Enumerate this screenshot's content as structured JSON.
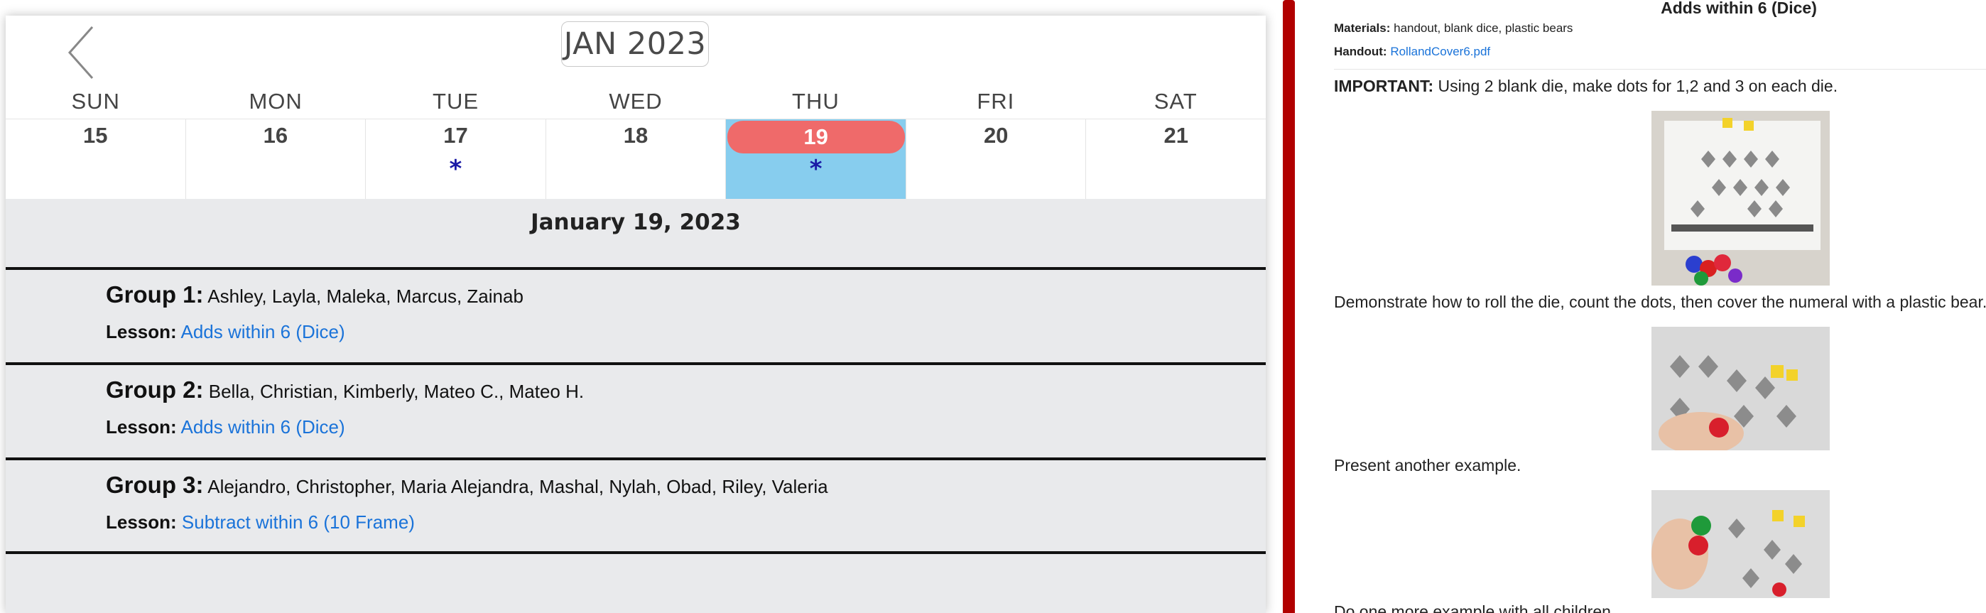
{
  "calendar": {
    "month_title": "JAN 2023",
    "prev_icon": "chevron-left-icon",
    "weekdays": [
      "SUN",
      "MON",
      "TUE",
      "WED",
      "THU",
      "FRI",
      "SAT"
    ],
    "days": [
      {
        "number": "15",
        "marker": ""
      },
      {
        "number": "16",
        "marker": ""
      },
      {
        "number": "17",
        "marker": "*"
      },
      {
        "number": "18",
        "marker": ""
      },
      {
        "number": "19",
        "marker": "*"
      },
      {
        "number": "20",
        "marker": ""
      },
      {
        "number": "21",
        "marker": ""
      }
    ],
    "selected_color": "#87cdee",
    "today_pill_color": "#ef6a6a"
  },
  "day_view": {
    "date_heading": "January 19, 2023",
    "lesson_label": "Lesson:",
    "groups": [
      {
        "name": "Group 1:",
        "students": "Ashley, Layla, Maleka, Marcus, Zainab",
        "lesson": "Adds within 6 (Dice)"
      },
      {
        "name": "Group 2:",
        "students": "Bella, Christian, Kimberly, Mateo C., Mateo H.",
        "lesson": "Adds within 6 (Dice)"
      },
      {
        "name": "Group 3:",
        "students": "Alejandro, Christopher, Maria Alejandra, Mashal, Nylah, Obad, Riley, Valeria",
        "lesson": "Subtract within 6 (10 Frame)"
      }
    ],
    "link_color": "#1a73d9"
  },
  "lesson_detail": {
    "title": "Adds within 6 (Dice)",
    "materials_label": "Materials:",
    "materials": "handout, blank dice, plastic bears",
    "handout_label": "Handout:",
    "handout_link": "RollandCover6.pdf",
    "important_label": "IMPORTANT:",
    "important_text": "Using 2 blank die, make dots for 1,2 and 3 on each die.",
    "step1": "Demonstrate how to roll the die, count the dots, then cover the numeral with a plastic bear.",
    "step2": "Present another example.",
    "step3": "Do one more example with all children."
  },
  "accent_color": "#b10000"
}
